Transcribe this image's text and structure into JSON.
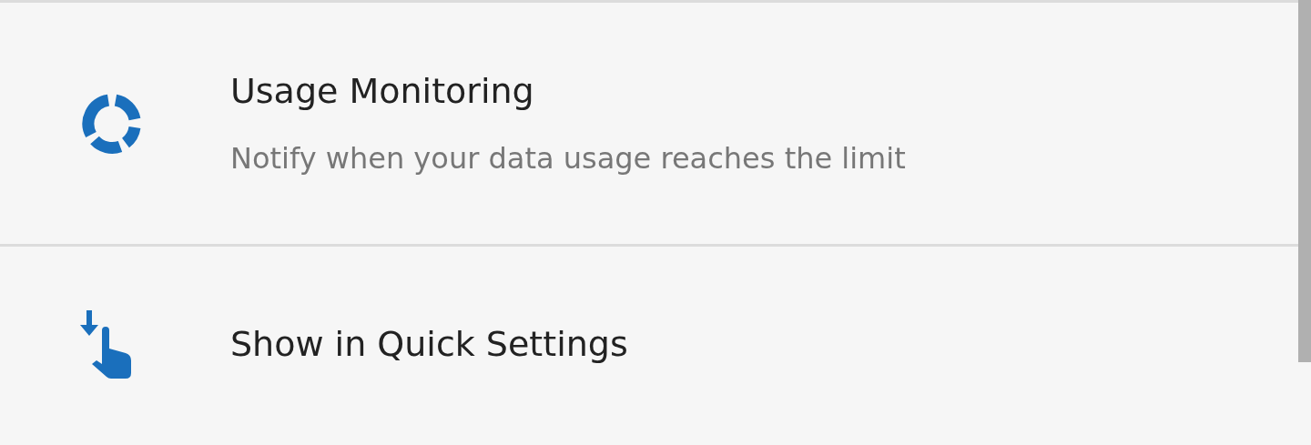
{
  "settings": [
    {
      "kind": "usage",
      "title": "Usage Monitoring",
      "subtitle": "Notify when your data usage reaches the limit"
    },
    {
      "kind": "quick",
      "title": "Show in Quick Settings"
    }
  ]
}
